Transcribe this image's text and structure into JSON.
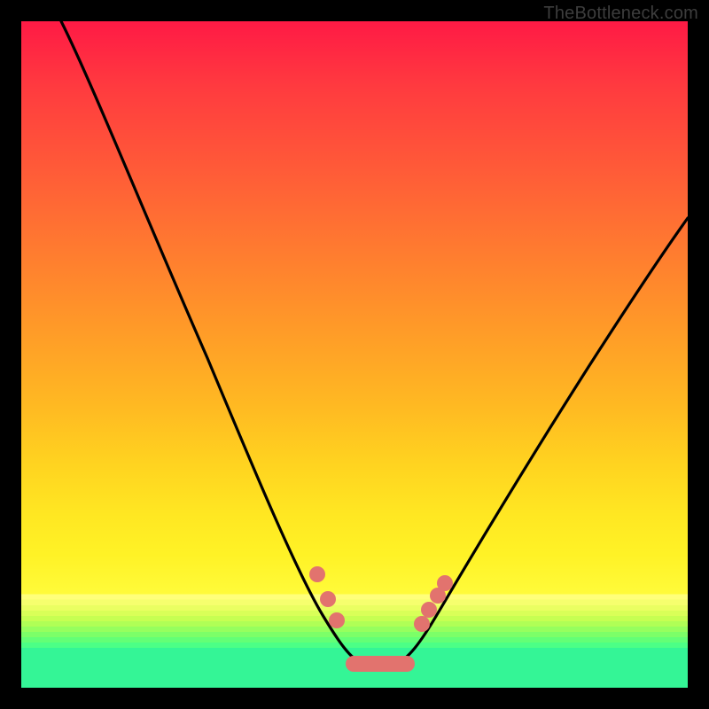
{
  "watermark": "TheBottleneck.com",
  "chart_data": {
    "type": "line",
    "title": "",
    "xlabel": "",
    "ylabel": "",
    "xlim": [
      0,
      100
    ],
    "ylim": [
      0,
      100
    ],
    "grid": false,
    "legend": false,
    "background_gradient": {
      "orientation": "vertical",
      "stops": [
        {
          "pos": 0,
          "color": "#ff1a45"
        },
        {
          "pos": 50,
          "color": "#ffa726"
        },
        {
          "pos": 82,
          "color": "#fff226"
        },
        {
          "pos": 100,
          "color": "#34f596"
        }
      ]
    },
    "series": [
      {
        "name": "bottleneck-curve",
        "color": "#000000",
        "x": [
          6,
          10,
          15,
          20,
          25,
          30,
          35,
          40,
          44,
          47,
          49,
          51,
          53,
          55,
          57,
          60,
          65,
          70,
          75,
          80,
          85,
          90,
          95,
          100
        ],
        "y": [
          100,
          92,
          82,
          71,
          60,
          49,
          38,
          27,
          17,
          10,
          6,
          4,
          4,
          4,
          6,
          10,
          18,
          26,
          33,
          40,
          46,
          52,
          57,
          62
        ]
      }
    ],
    "markers": [
      {
        "name": "left-cluster",
        "color": "#e2736e",
        "points": [
          {
            "x": 44,
            "y": 17
          },
          {
            "x": 45.5,
            "y": 13
          },
          {
            "x": 47,
            "y": 10
          }
        ]
      },
      {
        "name": "right-cluster",
        "color": "#e2736e",
        "points": [
          {
            "x": 57,
            "y": 6
          },
          {
            "x": 58.5,
            "y": 8
          },
          {
            "x": 60,
            "y": 10
          },
          {
            "x": 61,
            "y": 12
          }
        ]
      },
      {
        "name": "trough-bar",
        "color": "#e2736e",
        "shape": "rounded-bar",
        "x0": 48,
        "x1": 56,
        "y": 3.5
      }
    ]
  }
}
